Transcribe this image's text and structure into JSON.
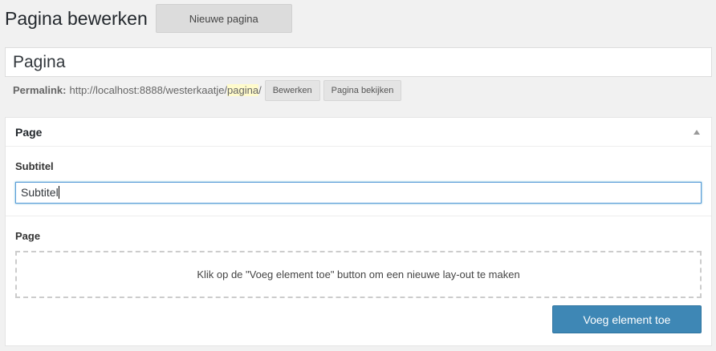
{
  "header": {
    "title": "Pagina bewerken",
    "add_new_label": "Nieuwe pagina"
  },
  "title_field": {
    "value": "Pagina"
  },
  "permalink": {
    "label": "Permalink:",
    "base_url": "http://localhost:8888/westerkaatje/",
    "slug": "pagina",
    "trailing": "/",
    "edit_label": "Bewerken",
    "view_label": "Pagina bekijken"
  },
  "metabox": {
    "title": "Page",
    "subtitle_label": "Subtitel",
    "subtitle_value": "Subtitel",
    "flex_label": "Page",
    "empty_message": "Klik op de \"Voeg element toe\" button om een nieuwe lay-out te maken",
    "add_element_label": "Voeg element toe"
  },
  "colors": {
    "primary_button": "#3e87b5",
    "slug_highlight": "#fffbcc",
    "focus_border": "#5b9dd9"
  },
  "icons": {
    "toggle": "triangle-up"
  }
}
